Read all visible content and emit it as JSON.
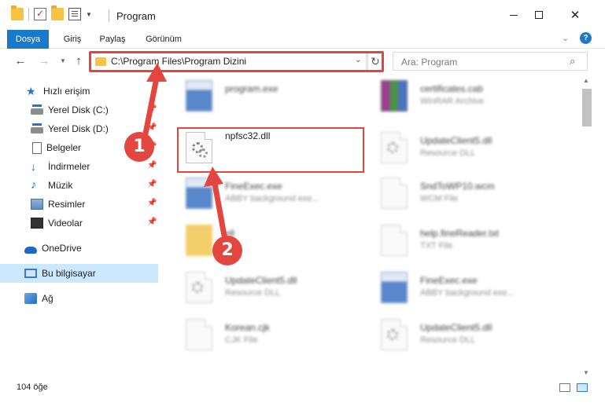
{
  "window": {
    "title": "Program",
    "controls": {
      "minimize": "",
      "maximize": "",
      "close": "✕"
    }
  },
  "ribbon": {
    "tabs": [
      "Dosya",
      "Giriş",
      "Paylaş",
      "Görünüm"
    ],
    "expand_icon": "chevron-down-icon",
    "help_label": "?"
  },
  "navigation": {
    "back": "←",
    "forward": "→",
    "recent": "⌄",
    "up": "↑",
    "address": "C:\\Program Files\\Program Dizini",
    "address_dropdown": "⌄",
    "refresh": "↻",
    "search_placeholder": "Ara: Program",
    "search_icon": "⌕"
  },
  "sidebar": {
    "items": [
      {
        "label": "Hızlı erişim",
        "icon": "star-icon",
        "pinned": false
      },
      {
        "label": "Yerel Disk (C:)",
        "icon": "drive-icon",
        "pinned": true
      },
      {
        "label": "Yerel Disk (D:)",
        "icon": "drive-icon",
        "pinned": true
      },
      {
        "label": "Belgeler",
        "icon": "document-icon",
        "pinned": true
      },
      {
        "label": "İndirmeler",
        "icon": "download-icon",
        "pinned": true
      },
      {
        "label": "Müzik",
        "icon": "music-icon",
        "pinned": true
      },
      {
        "label": "Resimler",
        "icon": "pictures-icon",
        "pinned": true
      },
      {
        "label": "Videolar",
        "icon": "video-icon",
        "pinned": true
      },
      {
        "label": "OneDrive",
        "icon": "cloud-icon",
        "pinned": false
      },
      {
        "label": "Bu bilgisayar",
        "icon": "computer-icon",
        "pinned": false,
        "selected": true
      },
      {
        "label": "Ağ",
        "icon": "network-icon",
        "pinned": false
      }
    ],
    "pin_glyph": "📌"
  },
  "files": [
    {
      "name": "program.exe",
      "type": "",
      "icon": "exe-icon",
      "blurred": true
    },
    {
      "name": "certificates.cab",
      "type": "WinRAR Archive",
      "icon": "archive-icon",
      "blurred": true
    },
    {
      "name": "npfsc32.dll",
      "type": "",
      "icon": "dll-gear-icon",
      "blurred": false,
      "highlighted": true
    },
    {
      "name": "UpdateClient5.dll",
      "type": "Resource DLL",
      "icon": "dll-gear-icon",
      "blurred": true
    },
    {
      "name": "FineExec.exe",
      "type": "ABBY background exe...",
      "icon": "exe-icon",
      "blurred": true
    },
    {
      "name": "SndToWP10.wcm",
      "type": "WCM File",
      "icon": "file-icon",
      "blurred": true
    },
    {
      "name": "ell",
      "type": "",
      "icon": "folder-icon",
      "blurred": true
    },
    {
      "name": "help.fineReader.txt",
      "type": "TXT File",
      "icon": "file-icon",
      "blurred": true
    },
    {
      "name": "UpdateClient5.dll",
      "type": "Resource DLL",
      "icon": "dll-gear-icon",
      "blurred": true
    },
    {
      "name": "FineExec.exe",
      "type": "ABBY background exe...",
      "icon": "exe-icon",
      "blurred": true
    },
    {
      "name": "Korean.cjk",
      "type": "CJK File",
      "icon": "file-icon",
      "blurred": true
    },
    {
      "name": "UpdateClient5.dll",
      "type": "Resource DLL",
      "icon": "dll-gear-icon",
      "blurred": true
    }
  ],
  "annotations": {
    "step1": "1",
    "step2": "2",
    "color": "#e2463f"
  },
  "status": {
    "item_count": "104 öğe"
  },
  "colors": {
    "accent": "#1979ca",
    "selection": "#cce8ff",
    "highlight_border": "#e0453f"
  }
}
